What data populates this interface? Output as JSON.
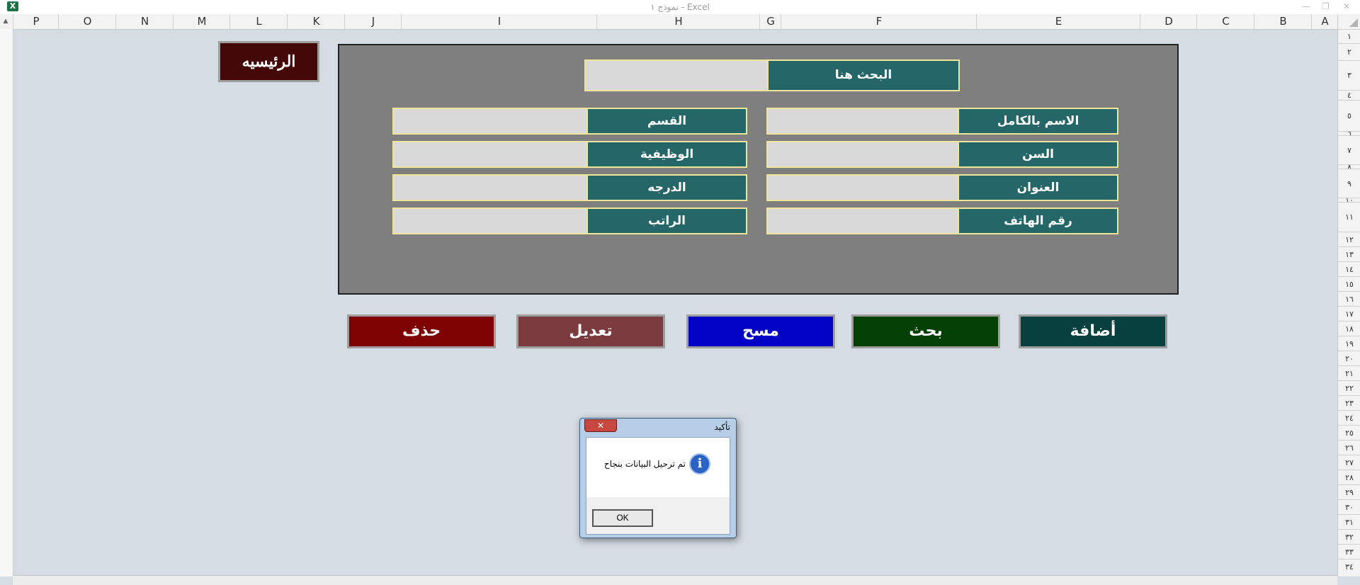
{
  "window": {
    "title": "نموذج ١ - Excel",
    "app_icon_label": "X",
    "minimize_glyph": "—",
    "restore_glyph": "❐",
    "close_glyph": "✕"
  },
  "sheet": {
    "columns": [
      "P",
      "O",
      "N",
      "M",
      "L",
      "K",
      "J",
      "I",
      "H",
      "G",
      "F",
      "E",
      "D",
      "C",
      "B",
      "A"
    ],
    "rows": [
      "١",
      "٢",
      "٣",
      "٤",
      "٥",
      "٦",
      "٧",
      "٨",
      "٩",
      "١٠",
      "١١",
      "١٢",
      "١٣",
      "١٤",
      "١٥",
      "١٦",
      "١٧",
      "١٨",
      "١٩",
      "٢٠",
      "٢١",
      "٢٢",
      "٢٣",
      "٢٤",
      "٢٥",
      "٢٦",
      "٢٧",
      "٢٨",
      "٢٩",
      "٣٠",
      "٣١",
      "٣٢",
      "٣٣",
      "٣٤"
    ],
    "scroll_up_glyph": "▲"
  },
  "form": {
    "home_button": "الرئيسيه",
    "search_label": "البحث هنا",
    "search_value": "",
    "fields": {
      "full_name": {
        "label": "الاسم بالكامل",
        "value": ""
      },
      "age": {
        "label": "السن",
        "value": ""
      },
      "address": {
        "label": "العنوان",
        "value": ""
      },
      "phone": {
        "label": "رقم الهاتف",
        "value": ""
      },
      "department": {
        "label": "القسم",
        "value": ""
      },
      "job": {
        "label": "الوظيفية",
        "value": ""
      },
      "grade": {
        "label": "الدرجه",
        "value": ""
      },
      "salary": {
        "label": "الراتب",
        "value": ""
      }
    },
    "buttons": {
      "add": "أضافة",
      "search": "بحث",
      "clear": "مسح",
      "edit": "تعديل",
      "delete": "حذف"
    }
  },
  "dialog": {
    "title": "تأكيد",
    "message": "تم ترحيل البيانات بنجاح",
    "ok_label": "OK",
    "close_glyph": "✕",
    "icon_glyph": "i"
  },
  "colors": {
    "sheet_bg": "#d6dce4",
    "panel_bg": "#7f7f7f",
    "label_bg": "#256669",
    "label_border": "#f1e59a",
    "input_bg": "#d9d9d9",
    "home_bg": "#440808",
    "add_bg": "#08403f",
    "search_bg": "#024004",
    "clear_bg": "#0202c4",
    "edit_bg": "#7b3b3e",
    "delete_bg": "#7e0202"
  }
}
